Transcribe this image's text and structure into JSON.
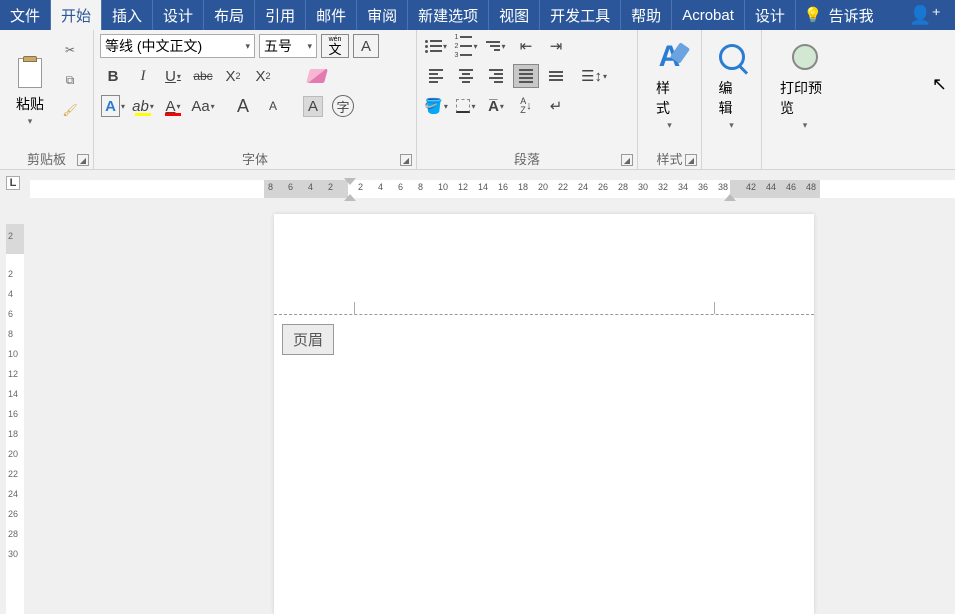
{
  "menu": {
    "file": "文件",
    "home": "开始",
    "insert": "插入",
    "design": "设计",
    "layout": "布局",
    "references": "引用",
    "mailings": "邮件",
    "review": "审阅",
    "newtab": "新建选项",
    "view": "视图",
    "devtools": "开发工具",
    "help": "帮助",
    "acrobat": "Acrobat",
    "design2": "设计",
    "tellme": "告诉我"
  },
  "ribbon": {
    "clipboard": {
      "paste": "粘贴",
      "label": "剪贴板"
    },
    "font": {
      "name": "等线 (中文正文)",
      "size": "五号",
      "wen": "文",
      "wen_top": "wén",
      "boxA": "A",
      "bold": "B",
      "italic": "I",
      "underline": "U",
      "strike": "abc",
      "sub": "X",
      "sup": "X",
      "outlineA": "A",
      "highlight": "ab",
      "fontcolor": "A",
      "caseAa": "Aa",
      "growA": "A",
      "shrinkA": "A",
      "shadedA": "A",
      "circleA": "字",
      "label": "字体"
    },
    "para": {
      "sortAZ": "A",
      "sortZ": "Z",
      "label": "段落"
    },
    "styles": {
      "title": "样式",
      "label": "样式"
    },
    "editing": {
      "title": "编辑"
    },
    "printpreview": {
      "title": "打印预览"
    }
  },
  "rulers": {
    "tabchar": "L",
    "hnums": [
      "8",
      "6",
      "4",
      "2",
      "2",
      "4",
      "6",
      "8",
      "10",
      "12",
      "14",
      "16",
      "18",
      "20",
      "22",
      "24",
      "26",
      "28",
      "30",
      "32",
      "34",
      "36",
      "38",
      "42",
      "44",
      "46",
      "48"
    ],
    "vnums": [
      "2",
      "2",
      "4",
      "6",
      "8",
      "10",
      "12",
      "14",
      "16",
      "18",
      "20",
      "22",
      "24",
      "26",
      "28",
      "30"
    ]
  },
  "doc": {
    "header_tag": "页眉"
  }
}
